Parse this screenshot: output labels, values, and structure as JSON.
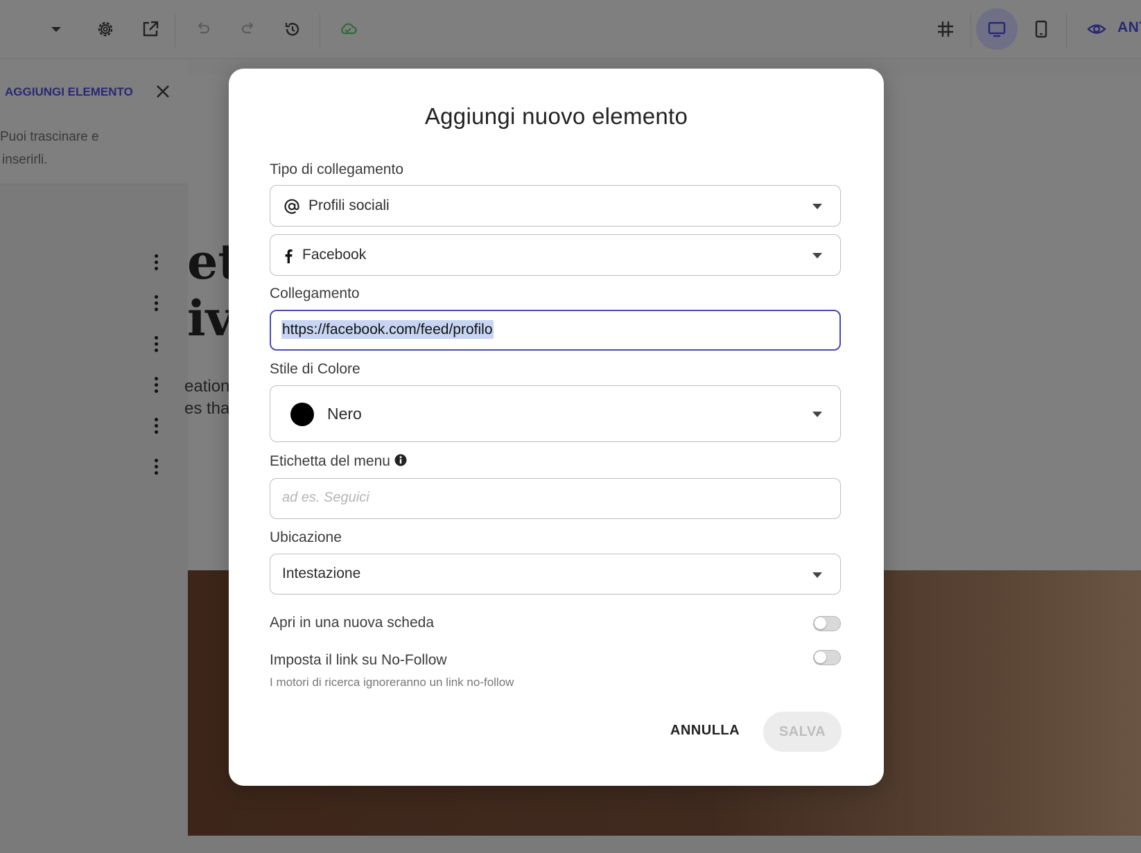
{
  "toolbar": {
    "icons": [
      "chevron-down-icon",
      "gear-icon",
      "open-external-icon",
      "undo-icon",
      "redo-icon",
      "history-icon",
      "cloud-sync-icon",
      "grid-icon",
      "desktop-icon",
      "mobile-icon",
      "eye-icon"
    ],
    "preview_label": "ANT"
  },
  "sidebar": {
    "title": "AGGIUNGI ELEMENTO",
    "description_line1": "Puoi trascinare e",
    "description_line2": "inserirli."
  },
  "canvas": {
    "heading_line1": "et",
    "heading_line2": "iv",
    "text_line1": "eation",
    "text_line2": "es tha"
  },
  "modal": {
    "title": "Aggiungi nuovo elemento",
    "link_type": {
      "label": "Tipo di collegamento",
      "value": "Profili sociali",
      "icon": "at-icon"
    },
    "network": {
      "value": "Facebook",
      "icon": "facebook-icon"
    },
    "link": {
      "label": "Collegamento",
      "value": "https://facebook.com/feed/profilo"
    },
    "color_style": {
      "label": "Stile di Colore",
      "value": "Nero",
      "swatch": "#000000"
    },
    "menu_label": {
      "label": "Etichetta del menu",
      "placeholder": "ad es. Seguici"
    },
    "location": {
      "label": "Ubicazione",
      "value": "Intestazione"
    },
    "open_new_tab": {
      "label": "Apri in una nuova scheda",
      "enabled": false
    },
    "no_follow": {
      "label": "Imposta il link su No-Follow",
      "hint": "I motori di ricerca ignoreranno un link no-follow",
      "enabled": false
    },
    "cancel_label": "ANNULLA",
    "save_label": "SALVA"
  },
  "colors": {
    "accent": "#4a47b8",
    "brand_dark": "#2a2875"
  }
}
